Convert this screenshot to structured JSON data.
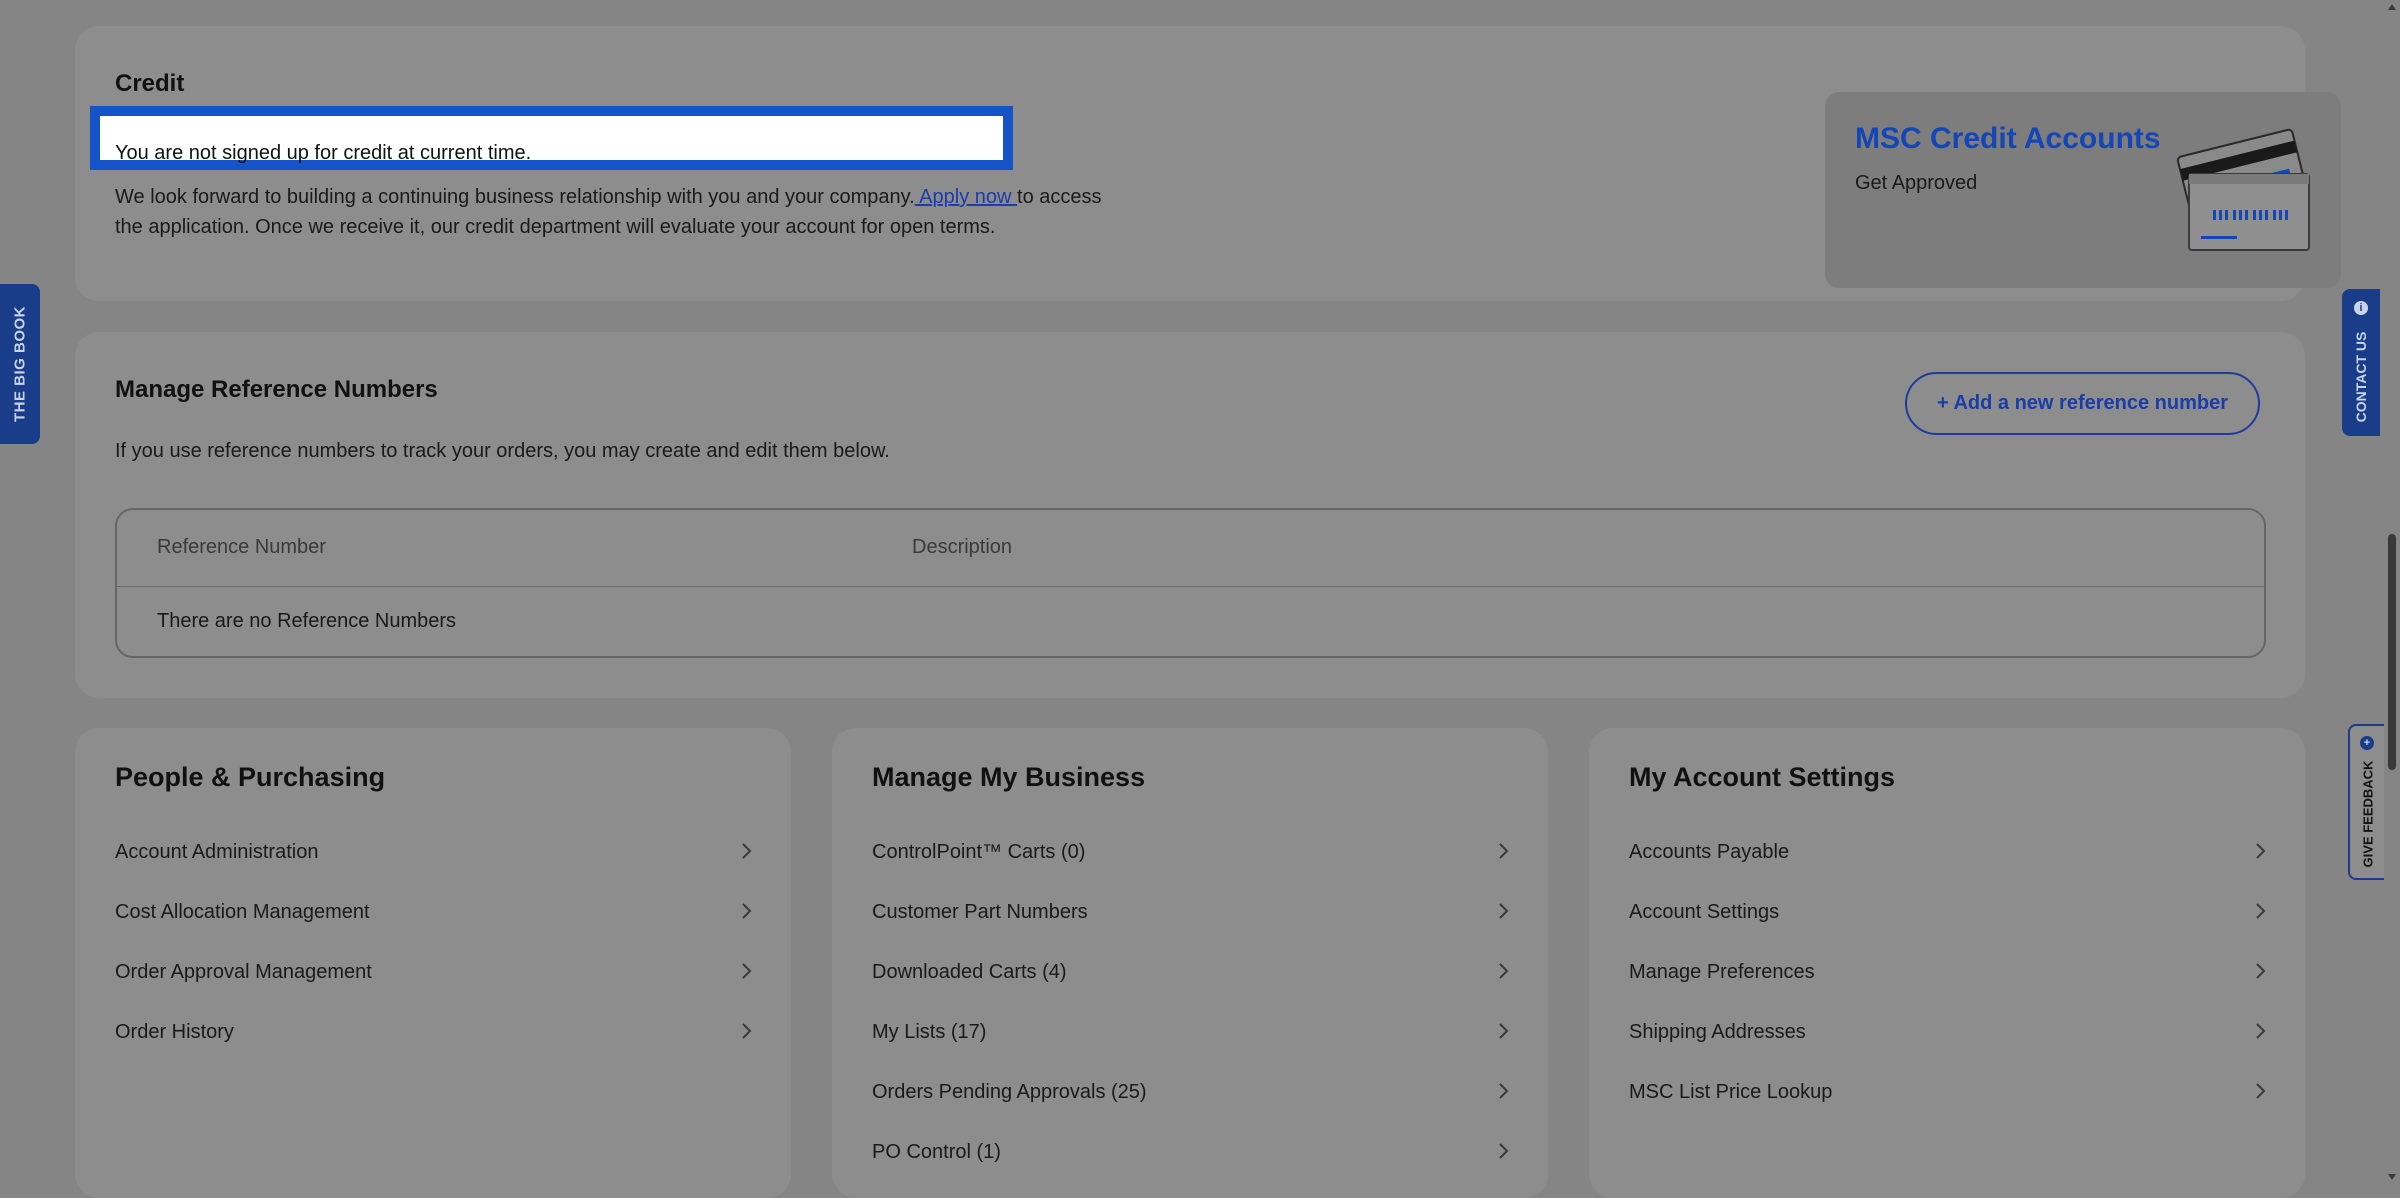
{
  "credit": {
    "title": "Credit",
    "status": "You are not signed up for credit at current time.",
    "body_line1_before": "We look forward to building a continuing business relationship with you and your company.",
    "apply_link": " Apply now ",
    "body_line1_after": "to access",
    "body_line2": "the application. Once we receive it, our credit department will evaluate your account for open terms.",
    "promo": {
      "title": "MSC Credit Accounts",
      "subtitle": "Get Approved"
    }
  },
  "reference": {
    "title": "Manage Reference Numbers",
    "description": "If you use reference numbers to track your orders, you may create and edit them below.",
    "add_button": "+ Add a new reference number",
    "columns": [
      "Reference Number",
      "Description"
    ],
    "empty_text": "There are no Reference Numbers"
  },
  "sections": [
    {
      "title": "People & Purchasing",
      "items": [
        "Account Administration",
        "Cost Allocation Management",
        "Order Approval Management",
        "Order History"
      ]
    },
    {
      "title": "Manage My Business",
      "items": [
        "ControlPoint™ Carts (0)",
        "Customer Part Numbers",
        "Downloaded Carts (4)",
        "My Lists (17)",
        "Orders Pending Approvals (25)",
        "PO Control (1)"
      ]
    },
    {
      "title": "My Account Settings",
      "items": [
        "Accounts Payable",
        "Account Settings",
        "Manage Preferences",
        "Shipping Addresses",
        "MSC List Price Lookup"
      ]
    }
  ],
  "side_tabs": {
    "big_book": "THE BIG BOOK",
    "contact": "CONTACT US",
    "feedback": "GIVE FEEDBACK"
  },
  "colors": {
    "accent": "#1553c8",
    "link": "#1a3da8",
    "overlay_bg": "#858585",
    "card_bg": "#8d8d8d"
  },
  "icons": {
    "chevron": "chevron-right-icon",
    "promo": "credit-card-illustration-icon",
    "info": "info-icon"
  }
}
